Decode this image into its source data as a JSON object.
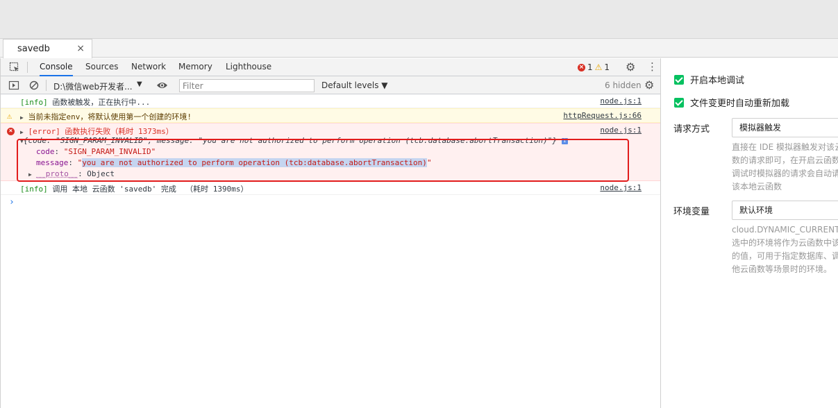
{
  "file_tab": {
    "label": "savedb",
    "close": "×"
  },
  "devtools_tabs": [
    {
      "label": "Console",
      "active": true
    },
    {
      "label": "Sources",
      "active": false
    },
    {
      "label": "Network",
      "active": false
    },
    {
      "label": "Memory",
      "active": false
    },
    {
      "label": "Lighthouse",
      "active": false
    }
  ],
  "counts": {
    "errors": "1",
    "warnings": "1"
  },
  "toolbar": {
    "context": "D:\\微信web开发者...",
    "filter_placeholder": "Filter",
    "levels": "Default levels ▼",
    "hidden": "6 hidden"
  },
  "console": {
    "line1": {
      "tag": "[info]",
      "text": " 函数被触发，正在执行中...",
      "src": "node.js:1"
    },
    "line2": {
      "text": "当前未指定env，将默认使用第一个创建的环境!",
      "src": "httpRequest.js:66"
    },
    "line3": {
      "text": "[error] 函数执行失败（耗时 1373ms）",
      "src": "node.js:1"
    },
    "obj_summary": "{code: \"SIGN_PARAM_INVALID\", message: \"you are not authorized to perform operation (tcb:database.abortTransaction)\"}",
    "code_key": "code",
    "code_val": "\"SIGN_PARAM_INVALID\"",
    "message_key": "message",
    "message_val": "you are not authorized to perform operation (tcb:database.abortTransaction)",
    "proto_key": "__proto__",
    "proto_val": ": Object",
    "line4": {
      "tag": "[info]",
      "text": " 调用 本地 云函数 'savedb' 完成  （耗时 1390ms）",
      "src": "node.js:1"
    },
    "prompt": "›"
  },
  "right_panel": {
    "checkbox1": "开启本地调试",
    "checkbox2": "文件变更时自动重新加载",
    "request_label": "请求方式",
    "request_value": "模拟器触发",
    "request_desc": "直接在 IDE 模拟器触发对该云\n数的请求即可，在开启云函数\n调试时模拟器的请求会自动请\n该本地云函数",
    "env_label": "环境变量",
    "env_value": "默认环境",
    "env_desc": "cloud.DYNAMIC_CURRENT\n选中的环境将作为云函数中该\n的值，可用于指定数据库、调\n他云函数等场景时的环境。"
  },
  "colors": {
    "accent": "#1a73e8",
    "error": "#d93025",
    "warning": "#e8a600",
    "checkbox": "#07c160",
    "annotation_box": "#e21c1c"
  }
}
